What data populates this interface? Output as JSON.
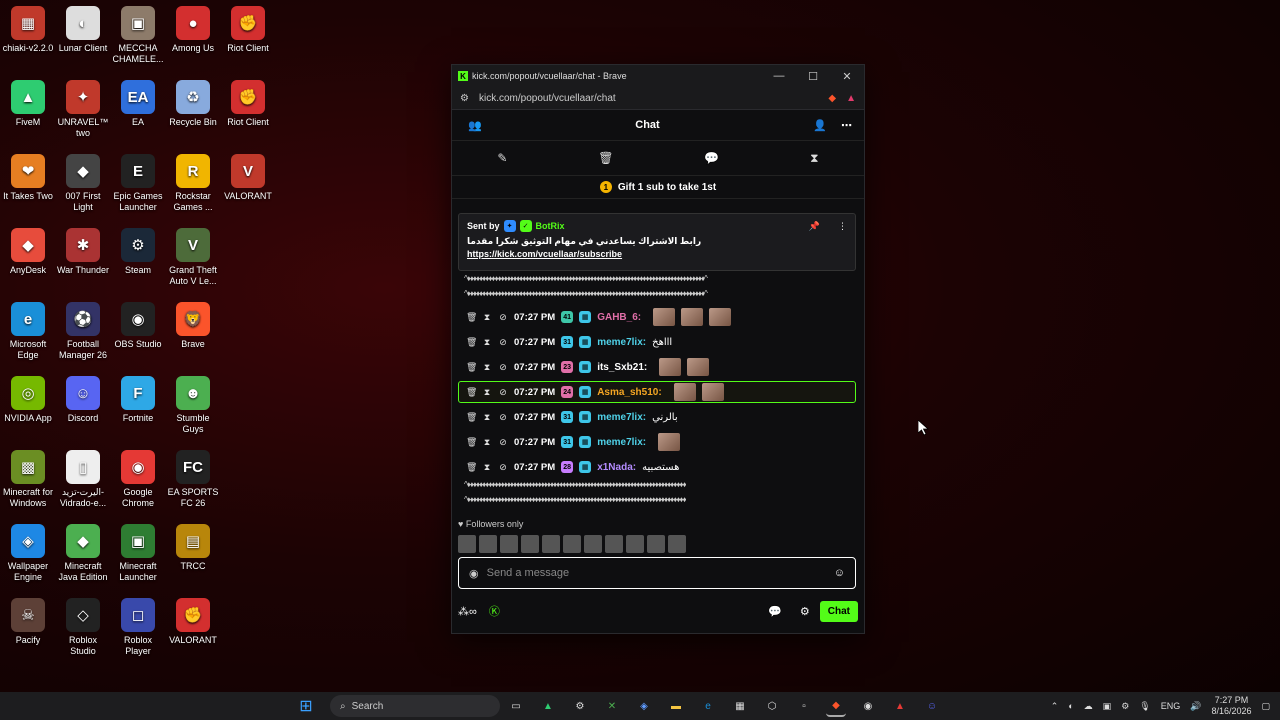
{
  "desktop": {
    "icons": [
      {
        "label": "chiaki-v2.2.0",
        "glyph": "▦",
        "color": "#c0392b"
      },
      {
        "label": "Lunar Client",
        "glyph": "◐",
        "color": "#dddddd"
      },
      {
        "label": "MECCHA CHAMELE...",
        "glyph": "▣",
        "color": "#8d7b6a"
      },
      {
        "label": "Among Us",
        "glyph": "●",
        "color": "#d32f2f"
      },
      {
        "label": "Riot Client",
        "glyph": "✊",
        "color": "#d32f2f"
      },
      {
        "label": "FiveM",
        "glyph": "▲",
        "color": "#2ecc71"
      },
      {
        "label": "UNRAVEL™ two",
        "glyph": "✦",
        "color": "#c0392b"
      },
      {
        "label": "EA",
        "glyph": "EA",
        "color": "#2f6fdc"
      },
      {
        "label": "Recycle Bin",
        "glyph": "♻",
        "color": "#88aadd"
      },
      {
        "label": "Riot Client",
        "glyph": "✊",
        "color": "#d32f2f"
      },
      {
        "label": "It Takes Two",
        "glyph": "❤",
        "color": "#e67e22"
      },
      {
        "label": "007 First Light",
        "glyph": "◆",
        "color": "#444444"
      },
      {
        "label": "Epic Games Launcher",
        "glyph": "E",
        "color": "#222222"
      },
      {
        "label": "Rockstar Games ...",
        "glyph": "R",
        "color": "#f1b500"
      },
      {
        "label": "VALORANT",
        "glyph": "V",
        "color": "#c0392b"
      },
      {
        "label": "AnyDesk",
        "glyph": "◆",
        "color": "#e74c3c"
      },
      {
        "label": "War Thunder",
        "glyph": "✱",
        "color": "#aa3333"
      },
      {
        "label": "Steam",
        "glyph": "⚙",
        "color": "#1b2838"
      },
      {
        "label": "Grand Theft Auto V Le...",
        "glyph": "V",
        "color": "#4d6b3a"
      },
      {
        "label": "",
        "glyph": "",
        "color": "transparent"
      },
      {
        "label": "Microsoft Edge",
        "glyph": "e",
        "color": "#1a8fd8"
      },
      {
        "label": "Football Manager 26",
        "glyph": "⚽",
        "color": "#333366"
      },
      {
        "label": "OBS Studio",
        "glyph": "◉",
        "color": "#222222"
      },
      {
        "label": "Brave",
        "glyph": "🦁",
        "color": "#fb542b"
      },
      {
        "label": "",
        "glyph": "",
        "color": "transparent"
      },
      {
        "label": "NVIDIA App",
        "glyph": "◎",
        "color": "#76b900"
      },
      {
        "label": "Discord",
        "glyph": "☺",
        "color": "#5865f2"
      },
      {
        "label": "Fortnite",
        "glyph": "F",
        "color": "#2ea8e6"
      },
      {
        "label": "Stumble Guys",
        "glyph": "☻",
        "color": "#4caf50"
      },
      {
        "label": "",
        "glyph": "",
        "color": "transparent"
      },
      {
        "label": "Minecraft for Windows",
        "glyph": "▩",
        "color": "#6b8e23"
      },
      {
        "label": "اليرت-تزيد-Vidrado-e...",
        "glyph": "▯",
        "color": "#eeeeee"
      },
      {
        "label": "Google Chrome",
        "glyph": "◉",
        "color": "#e53935"
      },
      {
        "label": "EA SPORTS FC 26",
        "glyph": "FC",
        "color": "#222222"
      },
      {
        "label": "",
        "glyph": "",
        "color": "transparent"
      },
      {
        "label": "Wallpaper Engine",
        "glyph": "◈",
        "color": "#1e88e5"
      },
      {
        "label": "Minecraft Java Edition",
        "glyph": "◆",
        "color": "#4caf50"
      },
      {
        "label": "Minecraft Launcher",
        "glyph": "▣",
        "color": "#2e7d32"
      },
      {
        "label": "TRCC",
        "glyph": "▤",
        "color": "#b8860b"
      },
      {
        "label": "",
        "glyph": "",
        "color": "transparent"
      },
      {
        "label": "Pacify",
        "glyph": "☠",
        "color": "#5d4037"
      },
      {
        "label": "Roblox Studio",
        "glyph": "◇",
        "color": "#222222"
      },
      {
        "label": "Roblox Player",
        "glyph": "◻",
        "color": "#3949ab"
      },
      {
        "label": "VALORANT",
        "glyph": "✊",
        "color": "#d32f2f"
      }
    ]
  },
  "window": {
    "title": "kick.com/popout/vcuellaar/chat - Brave",
    "url": "kick.com/popout/vcuellaar/chat",
    "chat_title": "Chat",
    "gift_text": "Gift 1 sub to take 1st",
    "gift_count": "1",
    "pinned": {
      "sent_by": "Sent by",
      "sender": "BotRix",
      "arabic": "رابط الاشتراك يساعدني في مهام التوثيق شكرا مقدما",
      "link": "https://kick.com/vcuellaar/subscribe"
    },
    "deco_line": "^♦♦♦♦♦♦♦♦♦♦♦♦♦♦♦♦♦♦♦♦♦♦♦♦♦♦♦♦♦♦♦♦♦♦♦♦♦♦♦♦♦♦♦♦♦♦♦♦♦♦♦♦♦♦♦♦♦♦♦♦♦♦♦♦♦♦♦♦♦♦♦♦♦♦♦♦♦^",
    "messages": [
      {
        "time": "07:27 PM",
        "badge": "41",
        "badge_color": "#3ec6a8",
        "user": "GAHB_6:",
        "user_color": "#e06fa8",
        "text": ""
      },
      {
        "time": "07:27 PM",
        "badge": "31",
        "badge_color": "#3ec6e8",
        "user": "meme7lix:",
        "user_color": "#4fd1e8",
        "text": "اااهخ"
      },
      {
        "time": "07:27 PM",
        "badge": "23",
        "badge_color": "#e06fa8",
        "user": "its_Sxb21:",
        "user_color": "#ffffff",
        "text": ""
      },
      {
        "time": "07:27 PM",
        "badge": "24",
        "badge_color": "#e06fa8",
        "user": "Asma_sh510:",
        "user_color": "#f5a623",
        "text": ""
      },
      {
        "time": "07:27 PM",
        "badge": "31",
        "badge_color": "#3ec6e8",
        "user": "meme7lix:",
        "user_color": "#4fd1e8",
        "text": "بالرني"
      },
      {
        "time": "07:27 PM",
        "badge": "31",
        "badge_color": "#3ec6e8",
        "user": "meme7lix:",
        "user_color": "#4fd1e8",
        "text": ""
      },
      {
        "time": "07:27 PM",
        "badge": "28",
        "badge_color": "#c77dff",
        "user": "x1Nada:",
        "user_color": "#b48cff",
        "text": "هستصبيه"
      }
    ],
    "followers_only": "Followers only",
    "input_placeholder": "Send a message",
    "chat_button": "Chat"
  },
  "taskbar": {
    "search": "Search",
    "lang": "ENG",
    "time": "7:27 PM",
    "date": "8/16/2026"
  },
  "colors": {
    "accent": "#53fc18"
  }
}
